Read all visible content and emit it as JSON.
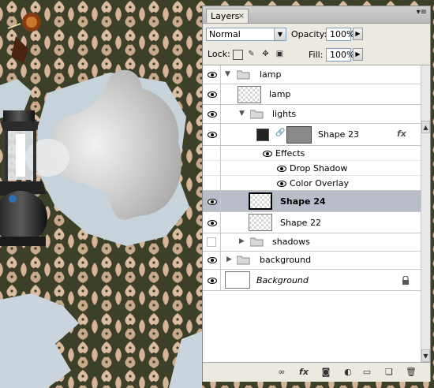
{
  "panel": {
    "tab_label": "Layers",
    "tab_close": "×",
    "menu_glyph": "▾≡",
    "blend_mode": "Normal",
    "opacity_label": "Opacity:",
    "opacity_value": "100%",
    "lock_label": "Lock:",
    "fill_label": "Fill:",
    "fill_value": "100%"
  },
  "layers": [
    {
      "name": "lamp",
      "type": "group",
      "visible": true,
      "expanded": true
    },
    {
      "name": "lamp",
      "type": "layer",
      "visible": true
    },
    {
      "name": "lights",
      "type": "group",
      "visible": true,
      "expanded": true
    },
    {
      "name": "Shape 23",
      "type": "shape",
      "visible": true,
      "fx": "fx"
    },
    {
      "name": "Effects",
      "type": "effects-header",
      "visible": true
    },
    {
      "name": "Drop Shadow",
      "type": "effect",
      "visible": true
    },
    {
      "name": "Color Overlay",
      "type": "effect",
      "visible": true
    },
    {
      "name": "Shape 24",
      "type": "layer",
      "visible": true,
      "selected": true
    },
    {
      "name": "Shape 22",
      "type": "layer",
      "visible": true
    },
    {
      "name": "shadows",
      "type": "group",
      "visible": false,
      "expanded": false
    },
    {
      "name": "background",
      "type": "group",
      "visible": true,
      "expanded": false
    },
    {
      "name": "Background",
      "type": "background",
      "visible": true,
      "locked": true
    }
  ],
  "bottom_icons": [
    "link-icon",
    "fx-icon",
    "mask-icon",
    "adjustment-icon",
    "new-group-icon",
    "new-layer-icon",
    "trash-icon"
  ],
  "colors": {
    "wallpaper_dark": "#3b3e2a",
    "wallpaper_pattern": "#d9b79a",
    "panel_bg": "#ece9e0",
    "selected_row": "#b9bcc9"
  }
}
